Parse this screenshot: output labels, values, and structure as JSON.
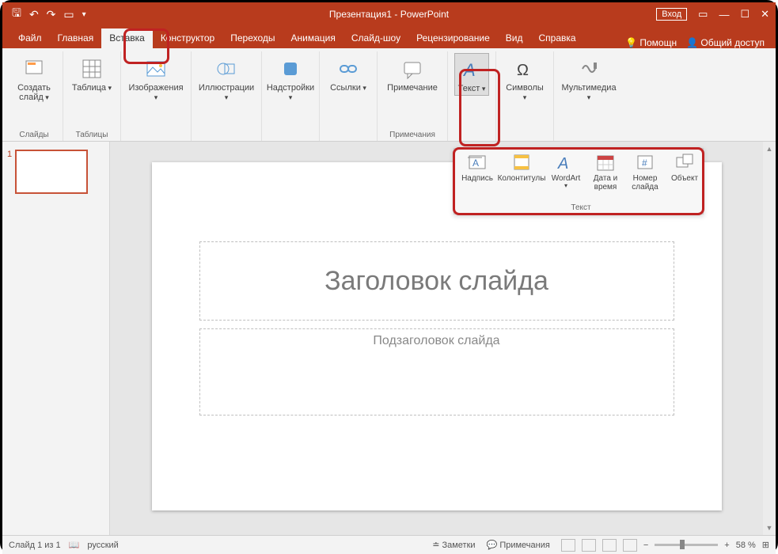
{
  "titlebar": {
    "title_doc": "Презентация1",
    "title_app": " - PowerPoint",
    "signin": "Вход"
  },
  "tabs": {
    "file": "Файл",
    "home": "Главная",
    "insert": "Вставка",
    "design": "Конструктор",
    "transitions": "Переходы",
    "animations": "Анимация",
    "slideshow": "Слайд-шоу",
    "review": "Рецензирование",
    "view": "Вид",
    "help": "Справка",
    "tellme": "Помощн",
    "share": "Общий доступ"
  },
  "ribbon": {
    "new_slide": "Создать слайд",
    "slides": "Слайды",
    "table": "Таблица",
    "tables": "Таблицы",
    "images": "Изображения",
    "illustrations": "Иллюстрации",
    "addins": "Надстройки",
    "links": "Ссылки",
    "comment": "Примечание",
    "comments": "Примечания",
    "text": "Текст",
    "symbols": "Символы",
    "media": "Мультимедиа"
  },
  "gallery": {
    "textbox": "Надпись",
    "headerfooter": "Колонтитулы",
    "wordart": "WordArt",
    "datetime": "Дата и время",
    "slidenum": "Номер слайда",
    "object": "Объект",
    "group": "Текст"
  },
  "slide": {
    "title_ph": "Заголовок слайда",
    "subtitle_ph": "Подзаголовок слайда",
    "thumb_num": "1"
  },
  "statusbar": {
    "slide": "Слайд 1 из 1",
    "lang": "русский",
    "notes": "Заметки",
    "comments": "Примечания",
    "zoom": "58 %"
  }
}
